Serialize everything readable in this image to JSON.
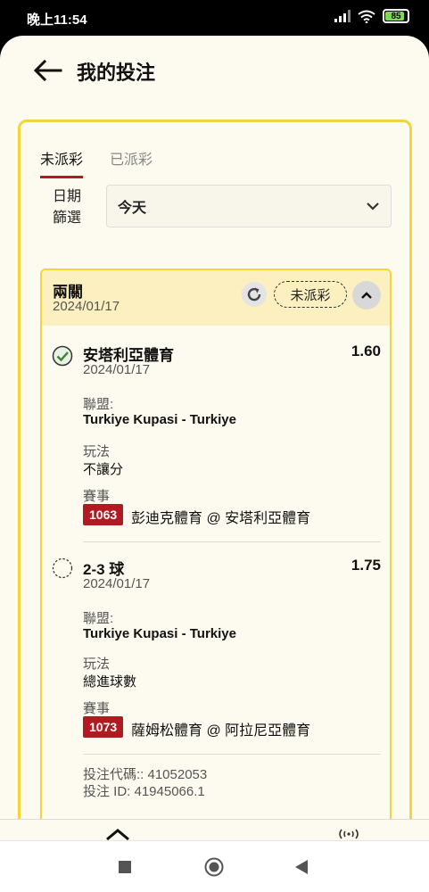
{
  "status_bar": {
    "time": "晚上11:54",
    "battery": "85"
  },
  "header": {
    "title": "我的投注"
  },
  "tabs": [
    {
      "label": "未派彩"
    },
    {
      "label": "已派彩"
    }
  ],
  "filter": {
    "label_line1": "日期",
    "label_line2": "篩選",
    "value": "今天"
  },
  "bet": {
    "type": "兩關",
    "date": "2024/01/17",
    "status": "未派彩",
    "selections": [
      {
        "name": "安塔利亞體育",
        "odds": "1.60",
        "date": "2024/01/17",
        "league_label": "聯盟:",
        "league": "Turkiye Kupasi - Turkiye",
        "market_label": "玩法",
        "market": "不讓分",
        "event_label": "賽事",
        "match_no": "1063",
        "match": "彭迪克體育 @ 安塔利亞體育",
        "state": "won"
      },
      {
        "name": "2-3 球",
        "odds": "1.75",
        "date": "2024/01/17",
        "league_label": "聯盟:",
        "league": "Turkiye Kupasi - Turkiye",
        "market_label": "玩法",
        "market": "總進球數",
        "event_label": "賽事",
        "match_no": "1073",
        "match": "薩姆松體育 @ 阿拉尼亞體育",
        "state": "pending"
      }
    ],
    "bet_code": "投注代碼:: 41052053",
    "bet_id": "投注 ID: 41945066.1"
  },
  "colors": {
    "accent": "#b01b22",
    "highlight": "#f3d53a",
    "card_header": "#fcf0c0"
  }
}
